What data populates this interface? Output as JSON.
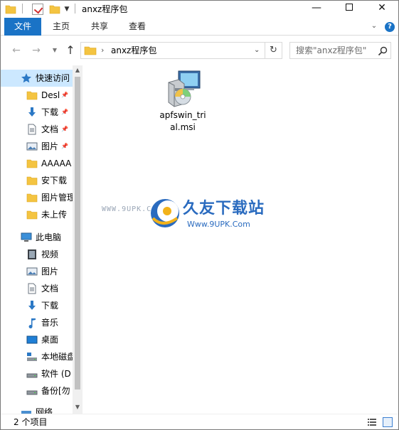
{
  "window": {
    "title": "anxz程序包",
    "controls": {
      "minimize": "—",
      "maximize": "",
      "close": "✕"
    }
  },
  "ribbon": {
    "tabs": [
      "文件",
      "主页",
      "共享",
      "查看"
    ],
    "help": "?"
  },
  "address_bar": {
    "path": "anxz程序包",
    "search_placeholder": "搜索\"anxz程序包\""
  },
  "nav_pane": {
    "items": [
      {
        "label": "快速访问",
        "icon": "star-icon",
        "pinned": false
      },
      {
        "label": "Desl",
        "icon": "folder-icon",
        "pinned": true
      },
      {
        "label": "下载",
        "icon": "download-arrow-icon",
        "pinned": true
      },
      {
        "label": "文档",
        "icon": "document-icon",
        "pinned": true
      },
      {
        "label": "图片",
        "icon": "pictures-icon",
        "pinned": true
      },
      {
        "label": "AAAAA",
        "icon": "folder-icon",
        "pinned": false
      },
      {
        "label": "安下载",
        "icon": "folder-icon",
        "pinned": false
      },
      {
        "label": "图片管理",
        "icon": "folder-icon",
        "pinned": false
      },
      {
        "label": "未上传",
        "icon": "folder-icon",
        "pinned": false
      },
      {
        "label": "此电脑",
        "icon": "computer-icon",
        "pinned": false
      },
      {
        "label": "视频",
        "icon": "video-icon",
        "pinned": false
      },
      {
        "label": "图片",
        "icon": "pictures-icon",
        "pinned": false
      },
      {
        "label": "文档",
        "icon": "document-icon",
        "pinned": false
      },
      {
        "label": "下载",
        "icon": "download-arrow-icon",
        "pinned": false
      },
      {
        "label": "音乐",
        "icon": "music-icon",
        "pinned": false
      },
      {
        "label": "桌面",
        "icon": "desktop-icon",
        "pinned": false
      },
      {
        "label": "本地磁盘",
        "icon": "local-disk-icon",
        "pinned": false
      },
      {
        "label": "软件 (D",
        "icon": "drive-icon",
        "pinned": false
      },
      {
        "label": "备份[勿",
        "icon": "drive-icon",
        "pinned": false
      },
      {
        "label": "网络",
        "icon": "network-icon",
        "pinned": false
      }
    ]
  },
  "content": {
    "files": [
      {
        "name": "apfswin_trial.msi",
        "name_line1": "apfswin_tri",
        "name_line2": "al.msi",
        "icon": "msi-installer-icon"
      }
    ]
  },
  "watermark": {
    "left_text": "WWW.9UPK.COM",
    "brand": "久友下载站",
    "url": "Www.9UPK.Com"
  },
  "status_bar": {
    "item_count": "2 个项目"
  },
  "colors": {
    "accent": "#1a73c6",
    "selection": "#cce8ff",
    "folder": "#f4c441"
  }
}
